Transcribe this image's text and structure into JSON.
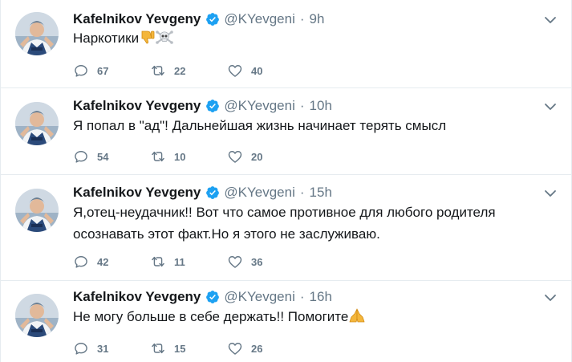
{
  "icons": {
    "verified": "verified-badge-icon",
    "caret": "chevron-down-icon",
    "reply": "reply-icon",
    "retweet": "retweet-icon",
    "like": "heart-icon"
  },
  "colors": {
    "name": "#14171a",
    "secondary": "#657786",
    "verified": "#1da1f2",
    "border": "#e6ecf0"
  },
  "tweets": [
    {
      "name": "Kafelnikov Yevgeny",
      "handle": "@KYevgeni",
      "separator": "·",
      "time": "9h",
      "text": "Наркотики",
      "emoji": [
        "thumbs-down-emoji",
        "skull-crossbones-emoji"
      ],
      "replies": "67",
      "retweets": "22",
      "likes": "40"
    },
    {
      "name": "Kafelnikov Yevgeny",
      "handle": "@KYevgeni",
      "separator": "·",
      "time": "10h",
      "text": "Я попал в \"ад\"! Дальнейшая жизнь начинает терять смысл",
      "replies": "54",
      "retweets": "10",
      "likes": "20"
    },
    {
      "name": "Kafelnikov Yevgeny",
      "handle": "@KYevgeni",
      "separator": "·",
      "time": "15h",
      "text_line1": "Я,отец-неудачник!! Вот что самое противное для любого родителя",
      "text_line2": "осознавать этот факт.Но я этого не заслуживаю.",
      "replies": "42",
      "retweets": "11",
      "likes": "36"
    },
    {
      "name": "Kafelnikov Yevgeny",
      "handle": "@KYevgeni",
      "separator": "·",
      "time": "16h",
      "text": "Не могу больше в себе держать!! Помогите",
      "emoji": [
        "folded-hands-emoji"
      ],
      "replies": "31",
      "retweets": "15",
      "likes": "26"
    }
  ]
}
